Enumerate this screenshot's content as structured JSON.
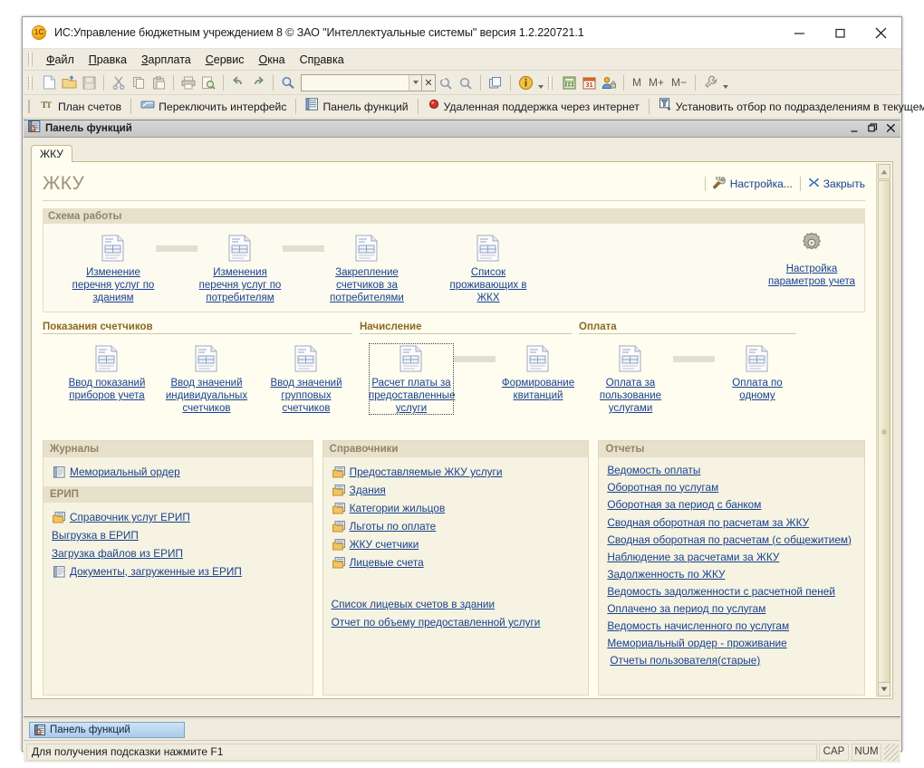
{
  "window": {
    "title": "ИС:Управление бюджетным учреждением 8 © ЗАО \"Интеллектуальные системы\" версия 1.2.220721.1",
    "app_icon": "1c-logo-icon",
    "minimize": "—",
    "maximize": "□",
    "close": "✕"
  },
  "menubar": {
    "items": [
      {
        "label": "Файл",
        "accel": "Ф"
      },
      {
        "label": "Правка",
        "accel": "П"
      },
      {
        "label": "Зарплата",
        "accel": "З"
      },
      {
        "label": "Сервис",
        "accel": "С"
      },
      {
        "label": "Окна",
        "accel": "О"
      },
      {
        "label": "Справка",
        "accel": "р"
      }
    ]
  },
  "toolbar_main": {
    "search_value": "",
    "search_placeholder": "",
    "memory_buttons": [
      "M",
      "M+",
      "M−"
    ],
    "icons": [
      "new-document-icon",
      "open-folder-icon",
      "save-icon",
      "cut-icon",
      "copy-icon",
      "paste-icon",
      "print-icon",
      "print-preview-icon",
      "undo-arrow-icon",
      "redo-arrow-icon",
      "search-icon",
      "find-next-icon",
      "find-prev-icon",
      "copy-window-icon",
      "info-icon",
      "calculator-icon",
      "calendar-icon",
      "user-lock-icon",
      "wrench-icon"
    ]
  },
  "toolbar_secondary": {
    "buttons": [
      {
        "label": "План счетов",
        "icon": "chart-of-accounts-icon"
      },
      {
        "label": "Переключить интерфейс",
        "icon": "switch-interface-icon"
      },
      {
        "label": "Панель функций",
        "icon": "functions-panel-icon"
      },
      {
        "label": "Удаленная поддержка через интернет",
        "icon": "remote-support-icon"
      },
      {
        "label": "Установить отбор по подразделениям в текущем сеансе",
        "icon": "filter-department-icon"
      }
    ]
  },
  "mdi": {
    "title": "Панель функций",
    "icon": "functions-panel-icon",
    "minimize": "_",
    "restore": "❐",
    "close": "✕"
  },
  "panel": {
    "tabs": [
      {
        "label": "ЖКУ",
        "active": true
      }
    ],
    "page_title": "ЖКУ",
    "actions": [
      {
        "label": "Настройка...",
        "icon": "settings-tools-icon"
      },
      {
        "label": "Закрыть",
        "icon": "close-x-icon"
      }
    ],
    "scheme": {
      "header": "Схема работы",
      "items": [
        {
          "label": "Изменение перечня услуг по зданиям",
          "icon": "document-icon",
          "connector_after": true
        },
        {
          "label": "Изменения перечня услуг по потребителям",
          "icon": "document-icon",
          "connector_after": true
        },
        {
          "label": "Закрепление счетчиков за потребителями",
          "icon": "document-icon",
          "connector_after": false
        },
        {
          "label": "Список проживающих в ЖКХ",
          "icon": "document-icon",
          "connector_after": false
        }
      ],
      "settings": {
        "label": "Настройка параметров учета",
        "icon": "gear-icon"
      }
    },
    "groups": [
      {
        "header": "Показания счетчиков",
        "items": [
          {
            "label": "Ввод показаний приборов учета",
            "icon": "document-icon",
            "connector_after": false,
            "focused": false
          },
          {
            "label": "Ввод значений индивидуальных счетчиков",
            "icon": "document-icon",
            "connector_after": false,
            "focused": false
          },
          {
            "label": "Ввод значений групповых счетчиков",
            "icon": "document-icon",
            "connector_after": false,
            "focused": false
          }
        ]
      },
      {
        "header": "Начисление",
        "items": [
          {
            "label": "Расчет платы за предоставленные услуги",
            "icon": "document-icon",
            "connector_after": true,
            "focused": true
          },
          {
            "label": "Формирование квитанций",
            "icon": "document-icon",
            "connector_after": false,
            "focused": false
          }
        ]
      },
      {
        "header": "Оплата",
        "items": [
          {
            "label": "Оплата за пользование услугами",
            "icon": "document-icon",
            "connector_after": true,
            "focused": false
          },
          {
            "label": "Оплата по одному",
            "icon": "document-icon",
            "connector_after": false,
            "focused": false
          }
        ]
      }
    ],
    "bottom_columns": [
      {
        "sections": [
          {
            "header": "Журналы",
            "links": [
              {
                "label": "Мемориальный ордер",
                "icon": "journal-icon"
              }
            ]
          },
          {
            "header": "ЕРИП",
            "links": [
              {
                "label": "Справочник услуг ЕРИП",
                "icon": "catalog-icon"
              },
              {
                "label": "Выгрузка в ЕРИП",
                "icon": ""
              },
              {
                "label": "Загрузка файлов из ЕРИП",
                "icon": ""
              },
              {
                "label": "Документы, загруженные из ЕРИП",
                "icon": "journal-icon"
              }
            ]
          }
        ]
      },
      {
        "sections": [
          {
            "header": "Справочники",
            "links": [
              {
                "label": "Предоставляемые ЖКУ услуги",
                "icon": "catalog-icon"
              },
              {
                "label": "Здания",
                "icon": "catalog-icon"
              },
              {
                "label": "Категории жильцов",
                "icon": "catalog-icon"
              },
              {
                "label": "Льготы по оплате",
                "icon": "catalog-icon"
              },
              {
                "label": "ЖКУ счетчики",
                "icon": "catalog-icon"
              },
              {
                "label": "Лицевые счета",
                "icon": "catalog-icon"
              },
              {
                "label": "",
                "icon": "",
                "gap": true
              },
              {
                "label": "Список лицевых счетов в здании",
                "icon": ""
              },
              {
                "label": "Отчет по объему предоставленной услуги",
                "icon": ""
              }
            ]
          }
        ]
      },
      {
        "sections": [
          {
            "header": "Отчеты",
            "links": [
              {
                "label": "Ведомость оплаты",
                "icon": ""
              },
              {
                "label": "Оборотная по услугам",
                "icon": ""
              },
              {
                "label": "Оборотная за период с банком",
                "icon": ""
              },
              {
                "label": "Сводная оборотная по расчетам за ЖКУ",
                "icon": ""
              },
              {
                "label": "Сводная оборотная по расчетам (с общежитием)",
                "icon": ""
              },
              {
                "label": "Наблюдение за расчетами за ЖКУ",
                "icon": ""
              },
              {
                "label": "Задолженность по ЖКУ",
                "icon": ""
              },
              {
                "label": "Ведомость задолженности с расчетной пеней",
                "icon": ""
              },
              {
                "label": "Оплачено за период по услугам",
                "icon": ""
              },
              {
                "label": "Ведомость начисленного по услугам",
                "icon": ""
              },
              {
                "label": "Мемориальный ордер - проживание",
                "icon": ""
              },
              {
                "label": "Отчеты пользователя(старые)",
                "icon": ""
              }
            ]
          }
        ]
      }
    ]
  },
  "taskbar": {
    "buttons": [
      {
        "label": "Панель функций",
        "icon": "functions-panel-icon",
        "active": true
      }
    ]
  },
  "statusbar": {
    "message": "Для получения подсказки нажмите F1",
    "indicators": [
      "CAP",
      "NUM"
    ]
  },
  "colors": {
    "link": "#17418f",
    "chrome": "#efebdf",
    "panel_bg": "#fffdf0",
    "section_hdr": "#e7e1cb",
    "section_hdr_text": "#8e8568",
    "group_hdr_text": "#8a6a22",
    "page_title": "#9c9377"
  }
}
